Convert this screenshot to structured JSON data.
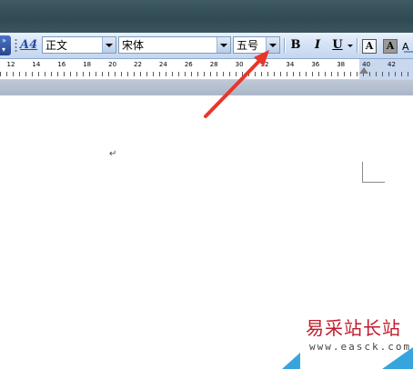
{
  "toolbar": {
    "style_icon": "A4",
    "style_value": "正文",
    "font_value": "宋体",
    "size_value": "五号",
    "bold_label": "B",
    "italic_label": "I",
    "underline_label": "U",
    "border_label": "A",
    "shading_label": "A"
  },
  "ruler": {
    "numbers": [
      "12",
      "14",
      "16",
      "18",
      "20",
      "22",
      "24",
      "26",
      "28",
      "30",
      "32",
      "34",
      "36",
      "38",
      "40",
      "42"
    ]
  },
  "document": {
    "paragraph_mark": "↵"
  },
  "watermark": {
    "title": "易采站长站",
    "url": "www.easck.com"
  },
  "colors": {
    "arrow": "#e8362a",
    "watermark": "#c21a2b",
    "accent": "#36a5de"
  }
}
